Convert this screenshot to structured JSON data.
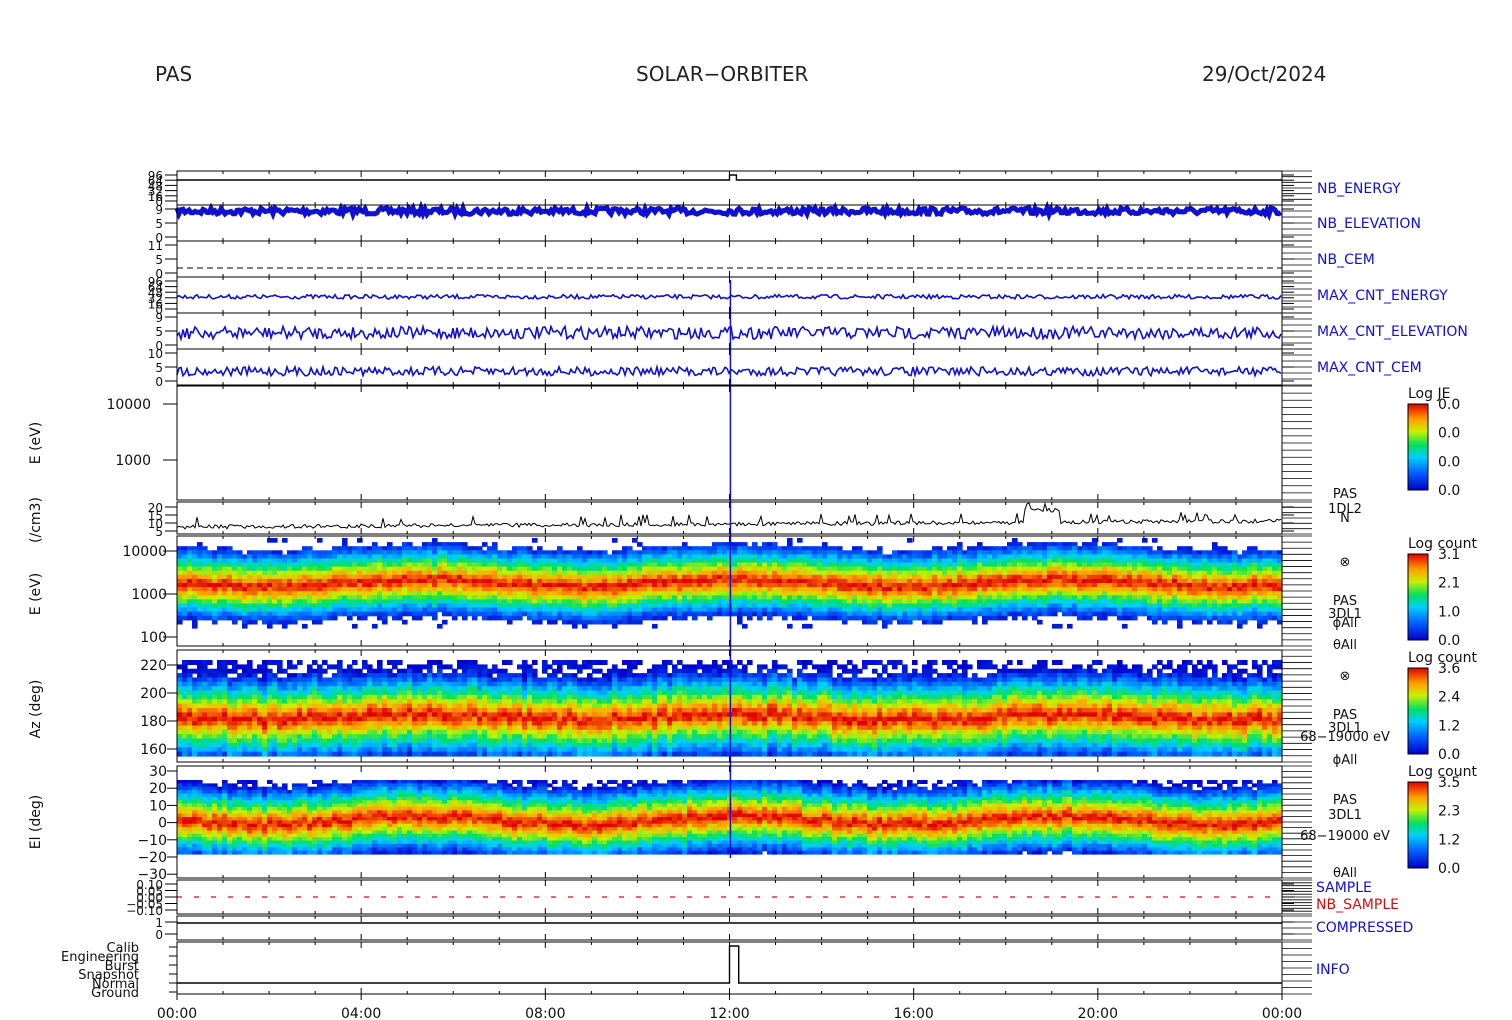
{
  "header": {
    "instrument": "PAS",
    "mission": "SOLAR−ORBITER",
    "date": "29/Oct/2024"
  },
  "colors": {
    "blue_trace": "#1010d0",
    "red_label": "#d01010",
    "axis": "#000000"
  },
  "chart_data": {
    "type": "multi-panel",
    "x_axis": {
      "range": [
        "00:00",
        "24:00"
      ],
      "ticks": [
        "00:00",
        "04:00",
        "08:00",
        "12:00",
        "16:00",
        "20:00",
        "00:00"
      ]
    },
    "panels": [
      {
        "id": "nb_energy",
        "label": "NB_ENERGY",
        "color": "blue",
        "yticks": [
          "96",
          "64",
          "48",
          "32",
          "16",
          "0"
        ],
        "mean": 1,
        "step_at_hour": 12.0
      },
      {
        "id": "nb_elevation",
        "label": "NB_ELEVATION",
        "color": "blue",
        "yticks": [
          "9",
          "5",
          "0"
        ],
        "mean": 7
      },
      {
        "id": "nb_cem",
        "label": "NB_CEM",
        "color": "blue",
        "yticks": [
          "11",
          "5",
          "0"
        ],
        "mean": 2
      },
      {
        "id": "max_cnt_energy",
        "label": "MAX_CNT_ENERGY",
        "color": "blue",
        "yticks": [
          "96",
          "64",
          "48",
          "32",
          "16",
          "0"
        ],
        "mean": 48
      },
      {
        "id": "max_cnt_elevation",
        "label": "MAX_CNT_ELEVATION",
        "color": "blue",
        "yticks": [
          "9",
          "5",
          "0"
        ],
        "mean": 4
      },
      {
        "id": "max_cnt_cem",
        "label": "MAX_CNT_CEM",
        "color": "blue",
        "yticks": [
          "10",
          "5",
          "0"
        ],
        "mean": 5
      },
      {
        "id": "je",
        "ylabel": "E (eV)",
        "yticks": [
          "10000",
          "1000"
        ],
        "colorbar": {
          "title": "Log JE",
          "ticks": [
            "0.0",
            "0.0",
            "0.0",
            "0.0"
          ]
        }
      },
      {
        "id": "density",
        "ylabel": "(/cm3)",
        "yticks": [
          "20",
          "15",
          "10",
          "5"
        ],
        "right_labels": [
          "PAS",
          "1DL2",
          "N"
        ],
        "baseline": 7,
        "bump_hour": 18.8,
        "bump_value": 17
      },
      {
        "id": "energy_spec",
        "ylabel": "E (eV)",
        "yticks": [
          "10000",
          "1000",
          "100"
        ],
        "peak_energy_eV": 1000,
        "right_labels": [
          "⊗",
          "PAS",
          "3DL1",
          "ϕAll",
          "θAll"
        ],
        "colorbar": {
          "title": "Log count",
          "ticks": [
            "3.1",
            "2.1",
            "1.0",
            "0.0"
          ]
        }
      },
      {
        "id": "azimuth",
        "ylabel": "Az (deg)",
        "yticks": [
          "220",
          "200",
          "180",
          "160"
        ],
        "peak_deg": 182,
        "right_labels": [
          "⊗",
          "PAS",
          "3DL1",
          "68−19000 eV",
          "ϕAll"
        ],
        "colorbar": {
          "title": "Log count",
          "ticks": [
            "3.6",
            "2.4",
            "1.2",
            "0.0"
          ]
        }
      },
      {
        "id": "elevation",
        "ylabel": "El (deg)",
        "yticks": [
          "30",
          "20",
          "10",
          "0",
          "−10",
          "−20",
          "−30"
        ],
        "peak_deg": -3,
        "right_labels": [
          "PAS",
          "3DL1",
          "68−19000 eV",
          "θAll"
        ],
        "colorbar": {
          "title": "Log count",
          "ticks": [
            "3.5",
            "2.3",
            "1.2",
            "0.0"
          ]
        }
      },
      {
        "id": "sample",
        "labels": [
          "SAMPLE",
          "NB_SAMPLE"
        ],
        "yticks": [
          "0.10",
          "0.05",
          "0.00",
          "−0.05",
          "−0.10"
        ],
        "value": 0.0
      },
      {
        "id": "compressed",
        "label": "COMPRESSED",
        "yticks": [
          "1",
          "0"
        ],
        "value": 1
      },
      {
        "id": "info",
        "label": "INFO",
        "yticks": [
          "Calib",
          "Engineering",
          "Burst",
          "Snapshot",
          "Normal",
          "Ground"
        ],
        "mode": "Normal",
        "pulse_hour": 12.0,
        "pulse_mode": "Calib"
      }
    ]
  }
}
